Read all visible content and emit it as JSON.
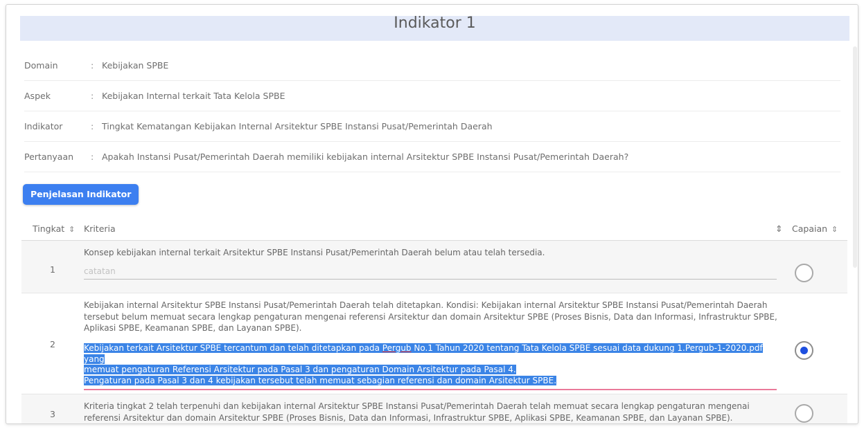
{
  "page": {
    "title": "Indikator 1"
  },
  "info": [
    {
      "label": "Domain",
      "sep": ":",
      "value": "Kebijakan SPBE"
    },
    {
      "label": "Aspek",
      "sep": ":",
      "value": "Kebijakan Internal terkait Tata Kelola SPBE"
    },
    {
      "label": "Indikator",
      "sep": ":",
      "value": "Tingkat Kematangan Kebijakan Internal Arsitektur SPBE Instansi Pusat/Pemerintah Daerah"
    },
    {
      "label": "Pertanyaan",
      "sep": ":",
      "value": "Apakah Instansi Pusat/Pemerintah Daerah memiliki kebijakan internal Arsitektur SPBE Instansi Pusat/Pemerintah Daerah?"
    }
  ],
  "buttons": {
    "penjelasan": "Penjelasan Indikator"
  },
  "table": {
    "headers": {
      "tingkat": "Tingkat",
      "kriteria": "Kriteria",
      "capaian": "Capaian"
    },
    "sort_icon": "⇕",
    "rows": [
      {
        "level": "1",
        "criteria": "Konsep kebijakan internal terkait Arsitektur SPBE Instansi Pusat/Pemerintah Daerah belum atau telah tersedia.",
        "note_placeholder": "catatan",
        "selected": false
      },
      {
        "level": "2",
        "criteria": "Kebijakan internal Arsitektur SPBE Instansi Pusat/Pemerintah Daerah telah ditetapkan. Kondisi: Kebijakan internal Arsitektur SPBE Instansi Pusat/Pemerintah Daerah tersebut belum memuat secara lengkap pengaturan mengenai referensi Arsitektur dan domain Arsitektur SPBE (Proses Bisnis, Data dan Informasi, Infrastruktur SPBE, Aplikasi SPBE, Keamanan SPBE, dan Layanan SPBE).",
        "note_line1_a": "Kebijakan terkait Arsitektur SPBE tercantum dan telah ditetapkan pada ",
        "note_line1_b": "Pergub",
        "note_line1_c": " No.1 Tahun 2020 tentang Tata Kelola SPBE sesuai data dukung 1.Pergub-1-2020.pdf yang",
        "note_line2": "memuat pengaturan Referensi Arsitektur pada Pasal 3 dan pengaturan Domain Arsitektur pada Pasal 4.",
        "note_line3": "Pengaturan pada Pasal 3 dan 4 kebijakan tersebut telah memuat sebagian referensi dan domain Arsitektur SPBE.",
        "selected": true
      },
      {
        "level": "3",
        "criteria": "Kriteria tingkat 2 telah terpenuhi dan kebijakan internal Arsitektur SPBE Instansi Pusat/Pemerintah Daerah telah memuat secara lengkap pengaturan mengenai referensi Arsitektur dan domain Arsitektur SPBE (Proses Bisnis, Data dan Informasi, Infrastruktur SPBE, Aplikasi SPBE, Keamanan SPBE, dan Layanan SPBE).",
        "selected": false
      }
    ]
  }
}
